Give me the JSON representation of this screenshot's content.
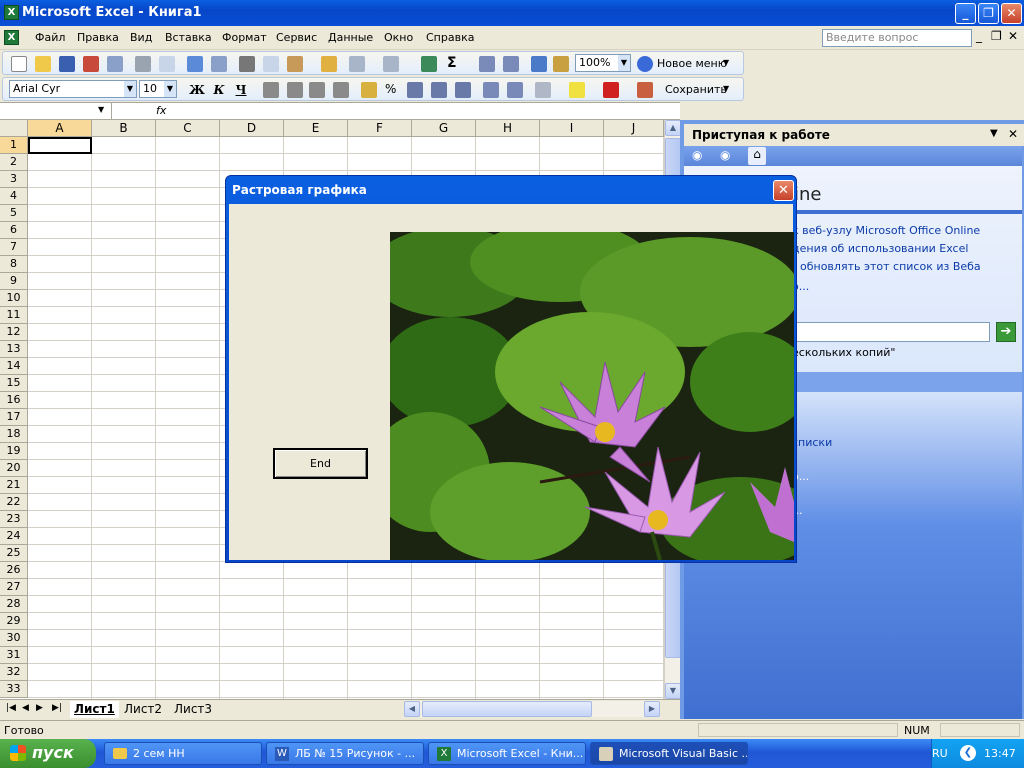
{
  "window": {
    "title": "Microsoft Excel - Книга1"
  },
  "menu": {
    "items": [
      "Файл",
      "Правка",
      "Вид",
      "Вставка",
      "Формат",
      "Сервис",
      "Данные",
      "Окно",
      "Справка"
    ],
    "ask_placeholder": "Введите вопрос"
  },
  "toolbar1": {
    "zoom": "100%",
    "new_menu": "Новое меню"
  },
  "toolbar2": {
    "font": "Arial Cyr",
    "size": "10",
    "bold": "Ж",
    "italic": "К",
    "underline": "Ч",
    "save_label": "Сохранить"
  },
  "formula": {
    "fx": "fx",
    "cell_ref": "",
    "value": ""
  },
  "sheet": {
    "columns": [
      "A",
      "B",
      "C",
      "D",
      "E",
      "F",
      "G",
      "H",
      "I",
      "J"
    ],
    "rows": [
      "1",
      "2",
      "3",
      "4",
      "5",
      "6",
      "7",
      "8",
      "9",
      "10",
      "11",
      "12",
      "13",
      "14",
      "15",
      "16",
      "17",
      "18",
      "19",
      "20",
      "21",
      "22",
      "23",
      "24",
      "25",
      "26",
      "27",
      "28",
      "29",
      "30",
      "31",
      "32",
      "33"
    ],
    "tabs": [
      "Лист1",
      "Лист2",
      "Лист3"
    ]
  },
  "status": {
    "ready": "Готово",
    "num": "NUM"
  },
  "task_pane": {
    "title": "Приступая к работе",
    "online_fragment": "ine",
    "links": [
      "к веб-узлу Microsoft Office Online",
      "дения об использовании Excel",
      "обновлять этот список из Веба",
      "о..."
    ],
    "search_note": "ескольких копий\"",
    "links2": [
      "списки",
      "о...",
      "..."
    ]
  },
  "dialog": {
    "title": "Растровая графика",
    "button": "End"
  },
  "taskbar": {
    "start": "пуск",
    "buttons": [
      "2 сем НН",
      "ЛБ № 15 Рисунок - ...",
      "Microsoft Excel - Кни...",
      "Microsoft Visual Basic ..."
    ],
    "lang": "RU",
    "time": "13:47"
  }
}
